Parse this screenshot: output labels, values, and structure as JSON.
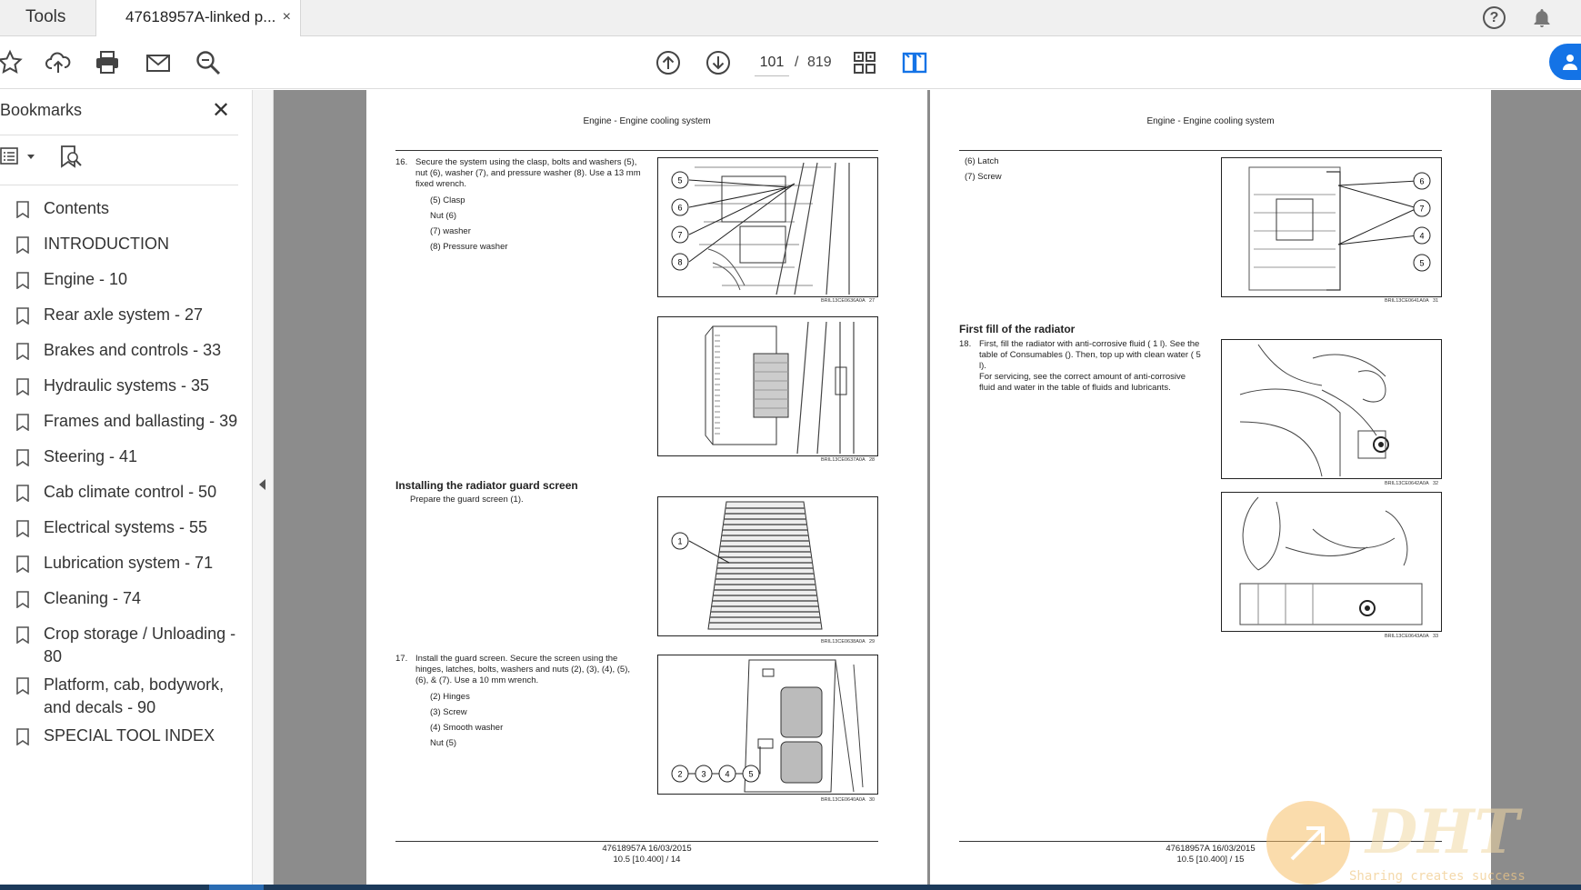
{
  "tabs": {
    "tools": "Tools",
    "document": "47618957A-linked p...",
    "close": "×"
  },
  "header_icons": {
    "help": "?",
    "bell": "bell-icon"
  },
  "toolbar": {
    "icons": [
      "star-icon",
      "upload-icon",
      "print-icon",
      "mail-icon",
      "zoom-icon",
      "page-up-icon",
      "page-down-icon",
      "fit-page-icon",
      "two-page-icon"
    ],
    "current_page": "101",
    "page_sep": "/",
    "total_pages": "819"
  },
  "sidebar": {
    "title": "Bookmarks",
    "close": "✕",
    "bookmarks": [
      "Contents",
      "INTRODUCTION",
      "Engine - 10",
      "Rear axle system - 27",
      "Brakes and controls - 33",
      "Hydraulic systems - 35",
      "Frames and ballasting - 39",
      "Steering - 41",
      "Cab climate control - 50",
      "Electrical systems - 55",
      "Lubrication system - 71",
      "Cleaning - 74",
      "Crop storage / Unloading - 80",
      "Platform, cab, bodywork, and decals - 90",
      "SPECIAL TOOL INDEX"
    ]
  },
  "left_page": {
    "header": "Engine - Engine cooling system",
    "step16_num": "16.",
    "step16_text": "Secure the system using the clasp, bolts and washers (5), nut (6), washer (7), and pressure washer (8). Use a 13 mm fixed wrench.",
    "step16_legend": [
      "(5) Clasp",
      "Nut (6)",
      "(7) washer",
      "(8) Pressure washer"
    ],
    "fig27_code": "BRIL13CE0636A0A",
    "fig27_num": "27",
    "fig28_code": "BRIL13CE0637A0A",
    "fig28_num": "28",
    "section_title": "Installing the radiator guard screen",
    "section_intro": "Prepare the guard screen (1).",
    "fig29_code": "BRIL13CE0638A0A",
    "fig29_num": "29",
    "step17_num": "17.",
    "step17_text": "Install the guard screen. Secure the screen using the hinges, latches, bolts, washers and nuts (2), (3), (4), (5), (6), & (7). Use a 10 mm wrench.",
    "step17_legend": [
      "(2) Hinges",
      "(3) Screw",
      "(4) Smooth washer",
      "Nut (5)"
    ],
    "fig30_code": "BRIL13CE0640A0A",
    "fig30_num": "30",
    "footer_line1": "47618957A 16/03/2015",
    "footer_line2": "10.5 [10.400] / 14",
    "callouts27": [
      "5",
      "6",
      "7",
      "8"
    ],
    "callouts29": [
      "1"
    ],
    "callouts30": [
      "2",
      "3",
      "4",
      "5"
    ]
  },
  "right_page": {
    "header": "Engine - Engine cooling system",
    "legend_top": [
      "(6) Latch",
      "(7) Screw"
    ],
    "fig31_code": "BRIL13CE0641A0A",
    "fig31_num": "31",
    "callouts31": [
      "6",
      "7",
      "4",
      "5"
    ],
    "section_title": "First fill of the radiator",
    "step18_num": "18.",
    "step18_text": "First, fill the radiator with anti-corrosive fluid ( 1 l). See the table of Consumables (). Then, top up with clean water ( 5 l).",
    "step18_text2": "For servicing, see the correct amount of anti-corrosive fluid and water in the table of fluids and lubricants.",
    "fig32_code": "BRIL13CE0642A0A",
    "fig32_num": "32",
    "fig33_code": "BRIL13CE0643A0A",
    "fig33_num": "33",
    "footer_line1": "47618957A 16/03/2015",
    "footer_line2": "10.5 [10.400] / 15"
  },
  "watermark": {
    "logo": "DHT",
    "tagline": "Sharing creates success"
  },
  "colors": {
    "accent": "#1473e6",
    "doc_bg": "#8c8c8c",
    "bottom_bar": "#1c3a5a"
  }
}
